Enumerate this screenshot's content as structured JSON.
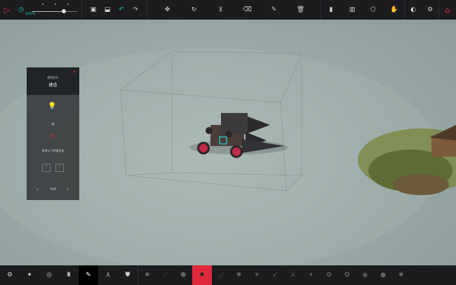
{
  "topbar": {
    "left": [
      {
        "name": "play-icon",
        "glyph": "▷"
      },
      {
        "name": "timer-icon",
        "glyph": "◷"
      }
    ],
    "time_scale": {
      "label": "100%",
      "value": 0.7
    },
    "file": [
      {
        "name": "save-icon",
        "glyph": "▣"
      },
      {
        "name": "load-icon",
        "glyph": "⬓"
      },
      {
        "name": "undo-icon",
        "glyph": "↶"
      },
      {
        "name": "redo-icon",
        "glyph": "↷"
      }
    ],
    "tools": [
      {
        "name": "move-icon",
        "glyph": "✥"
      },
      {
        "name": "rotate-icon",
        "glyph": "↻"
      },
      {
        "name": "flip-icon",
        "glyph": "⊻"
      },
      {
        "name": "eraser-icon",
        "glyph": "⌫"
      },
      {
        "name": "pen-icon",
        "glyph": "✎"
      },
      {
        "name": "trash-icon",
        "glyph": "🗑"
      }
    ],
    "right": [
      {
        "name": "bookmark-icon",
        "glyph": "▮"
      },
      {
        "name": "stats-icon",
        "glyph": "▥"
      },
      {
        "name": "cube-icon",
        "glyph": "⬡"
      },
      {
        "name": "hand-icon",
        "glyph": "✋"
      },
      {
        "name": "toggle-icon",
        "glyph": "◐"
      },
      {
        "name": "settings-icon",
        "glyph": "⚙"
      },
      {
        "name": "home-icon",
        "glyph": "⌂"
      }
    ]
  },
  "panel": {
    "subtitle": "教程积件",
    "title": "建造",
    "close_glyph": "✕",
    "bulb_glyph": "💡",
    "key_label": "键",
    "key_glyph": "⏻",
    "hint": "再按以下按键添加",
    "btn_down": "˅",
    "btn_up": "˄",
    "prev_glyph": "‹",
    "next_glyph": "›",
    "page": "6/6"
  },
  "bottombar": {
    "categories": [
      {
        "name": "category-basic-icon",
        "glyph": "⚙",
        "active": false
      },
      {
        "name": "category-blocks-icon",
        "glyph": "✦",
        "active": false
      },
      {
        "name": "category-mechanical-icon",
        "glyph": "◎",
        "active": false
      },
      {
        "name": "category-weapons-icon",
        "glyph": "♜",
        "active": false
      },
      {
        "name": "category-tools-icon",
        "glyph": "✎",
        "active": true
      },
      {
        "name": "category-flight-icon",
        "glyph": "⅄",
        "active": false
      },
      {
        "name": "category-armour-icon",
        "glyph": "⛊",
        "active": false
      }
    ],
    "parts": [
      {
        "name": "part-spike-icon",
        "glyph": "✹",
        "selected": false
      },
      {
        "name": "part-blade-icon",
        "glyph": "⟋",
        "selected": false
      },
      {
        "name": "part-shield-icon",
        "glyph": "⬟",
        "selected": false
      },
      {
        "name": "part-spinning-saw-icon",
        "glyph": "✸",
        "selected": true
      },
      {
        "name": "part-sword-icon",
        "glyph": "／",
        "selected": false
      },
      {
        "name": "part-drill-icon",
        "glyph": "✺",
        "selected": false
      },
      {
        "name": "part-mace-icon",
        "glyph": "✷",
        "selected": false
      },
      {
        "name": "part-spear-icon",
        "glyph": "➶",
        "selected": false
      },
      {
        "name": "part-axe-icon",
        "glyph": "⚔",
        "selected": false
      },
      {
        "name": "part-claw-icon",
        "glyph": "✦",
        "selected": false
      },
      {
        "name": "part-grinder-icon",
        "glyph": "❂",
        "selected": false
      },
      {
        "name": "part-flame-icon",
        "glyph": "✪",
        "selected": false
      },
      {
        "name": "part-fire-icon",
        "glyph": "◉",
        "selected": false
      },
      {
        "name": "part-bomb-icon",
        "glyph": "●",
        "selected": false
      },
      {
        "name": "part-extra-icon",
        "glyph": "✱",
        "selected": false
      }
    ]
  },
  "colors": {
    "accent": "#e0293b",
    "timer": "#1ec8b4",
    "bar": "#1c1c1f"
  }
}
